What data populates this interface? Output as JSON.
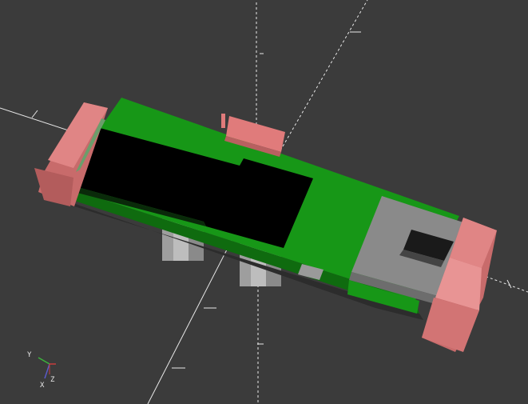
{
  "viewport": {
    "background": "#3b3b3b",
    "render_mode": "3d-preview"
  },
  "axes_indicator": {
    "x_label": "X",
    "y_label": "Y",
    "z_label": "Z",
    "x_color": "#c83c3c",
    "y_color": "#3cb43c",
    "z_color": "#5a5ac8"
  },
  "model": {
    "pcb_color": "#179717",
    "chip_color": "#000000",
    "connector_color": "#8a8a8a",
    "clip_color": "#e07b7b",
    "standoff_color": "#bdbdbd"
  }
}
